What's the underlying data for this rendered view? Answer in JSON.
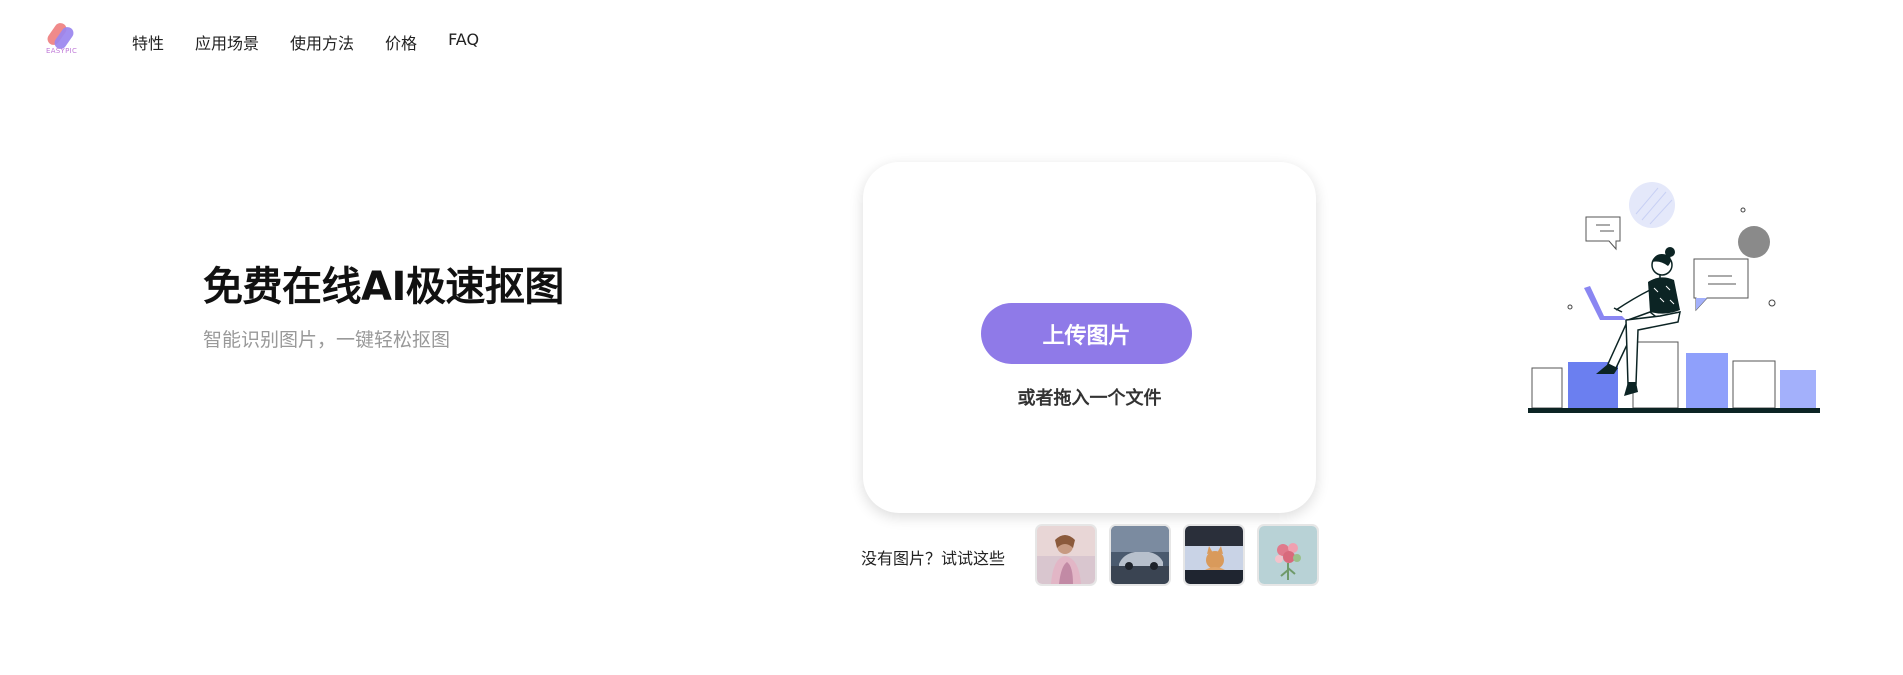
{
  "header": {
    "logo_text": "EASYPIC",
    "nav": [
      {
        "label": "特性"
      },
      {
        "label": "应用场景"
      },
      {
        "label": "使用方法"
      },
      {
        "label": "价格"
      },
      {
        "label": "FAQ"
      }
    ]
  },
  "hero": {
    "title": "免费在线AI极速抠图",
    "subtitle": "智能识别图片，一键轻松抠图"
  },
  "upload": {
    "button_label": "上传图片",
    "drop_text": "或者拖入一个文件"
  },
  "samples": {
    "label": "没有图片？试试这些",
    "items": [
      "woman-portrait-thumbnail",
      "car-thumbnail",
      "cat-in-car-thumbnail",
      "flowers-thumbnail"
    ]
  },
  "colors": {
    "accent": "#8f7ae8",
    "bar_blue": "#6b7ff0",
    "bar_light": "#a3b0fb",
    "text_muted": "#999999"
  }
}
